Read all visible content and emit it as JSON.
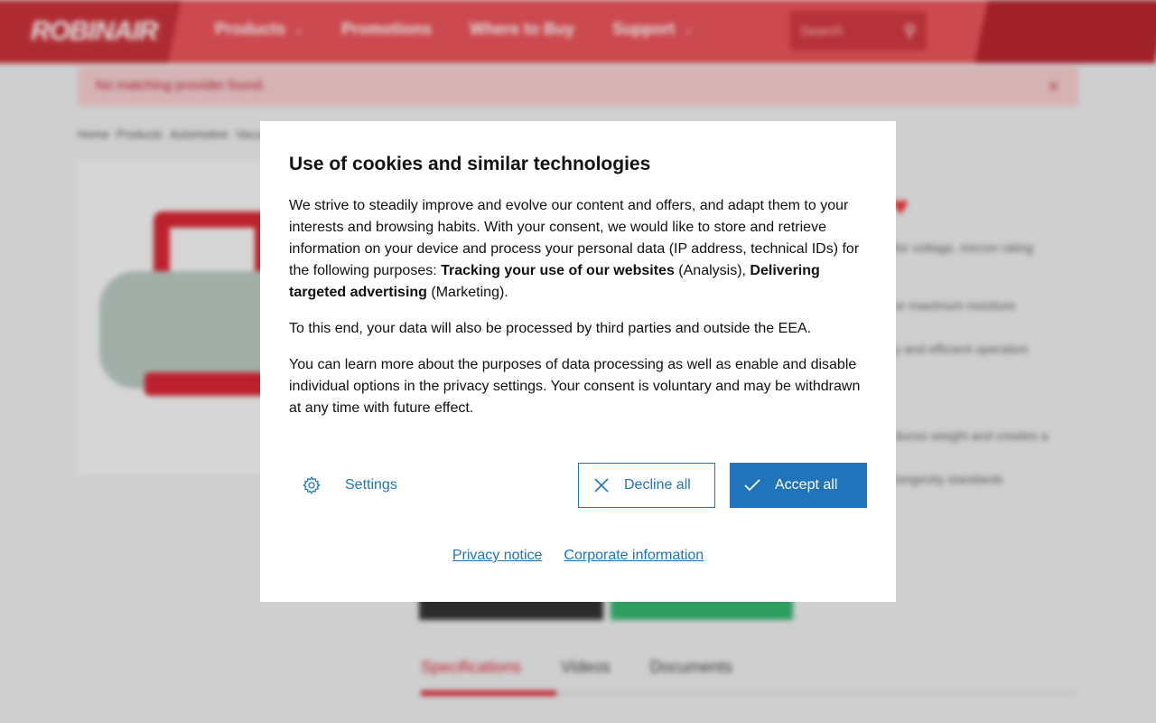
{
  "site": {
    "logo_text": "ROBINAIR",
    "nav": [
      {
        "label": "Products",
        "has_dropdown": true
      },
      {
        "label": "Promotions",
        "has_dropdown": false
      },
      {
        "label": "Where to Buy",
        "has_dropdown": false
      },
      {
        "label": "Support",
        "has_dropdown": true
      }
    ],
    "search_placeholder": "Search",
    "alert_text": "No matching provider found.",
    "breadcrumb": [
      "Home",
      "Products",
      "Automotive",
      "Vacuum Pumps"
    ],
    "feature_lines": [
      "for voltage, micron rating",
      "or maximum moisture",
      "y and efficient operation",
      "duces weight and creates a",
      "longevity standards"
    ],
    "tabs": [
      "Specifications",
      "Videos",
      "Documents"
    ],
    "active_tab": "Specifications"
  },
  "cookie_dialog": {
    "title": "Use of cookies and similar technologies",
    "p1_intro": "We strive to steadily improve and evolve our content and offers, and adapt them to your interests and browsing habits. With your consent, we would like to store and retrieve information on your device and process your personal data (IP address, technical IDs) for the following purposes: ",
    "p1_purpose1": "Tracking your use of our websites",
    "p1_purpose1_suffix": " (Analysis), ",
    "p1_purpose2": "Delivering targeted advertising",
    "p1_purpose2_suffix": " (Marketing).",
    "p2": "To this end, your data will also be processed by third parties and outside the EEA.",
    "p3": "You can learn more about the purposes of data processing as well as enable and disable individual options in the privacy settings. Your consent is voluntary and may be withdrawn at any time with future effect.",
    "settings_label": "Settings",
    "decline_label": "Decline all",
    "accept_label": "Accept all",
    "privacy_link": "Privacy notice",
    "corporate_link": "Corporate information"
  },
  "colors": {
    "brand_red": "#d82634",
    "action_blue": "#1f74bb"
  }
}
